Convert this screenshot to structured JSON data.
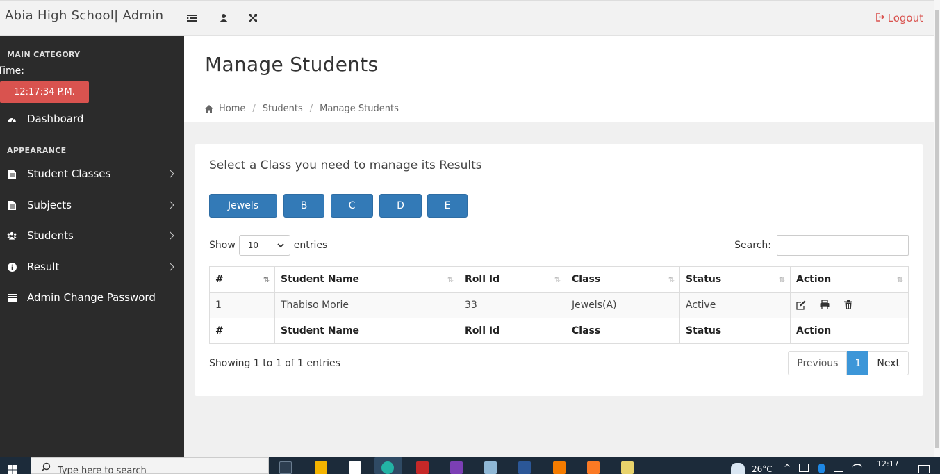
{
  "header": {
    "brand": "Abia High School| Admin",
    "logout_label": "Logout"
  },
  "sidebar": {
    "section1": "MAIN CATEGORY",
    "time_label": "Time:",
    "time_value": "12:17:34 P.M.",
    "dashboard": "Dashboard",
    "section2": "APPEARANCE",
    "items": [
      {
        "label": "Student Classes"
      },
      {
        "label": "Subjects"
      },
      {
        "label": "Students"
      },
      {
        "label": "Result"
      }
    ],
    "change_password": "Admin Change Password"
  },
  "page": {
    "title": "Manage Students",
    "breadcrumb": [
      "Home",
      "Students",
      "Manage Students"
    ]
  },
  "panel": {
    "title": "Select a Class you need to manage its Results",
    "classes": [
      "Jewels",
      "B",
      "C",
      "D",
      "E"
    ],
    "show_label": "Show",
    "show_value": "10",
    "entries_label": "entries",
    "search_label": "Search:",
    "search_value": ""
  },
  "table": {
    "headers": [
      "#",
      "Student Name",
      "Roll Id",
      "Class",
      "Status",
      "Action"
    ],
    "rows": [
      {
        "num": "1",
        "name": "Thabiso Morie",
        "roll": "33",
        "class": "Jewels(A)",
        "status": "Active"
      }
    ]
  },
  "footer": {
    "info": "Showing 1 to 1 of 1 entries",
    "prev": "Previous",
    "page": "1",
    "next": "Next"
  },
  "taskbar": {
    "search_placeholder": "Type here to search",
    "temperature": "26°C",
    "clock": "12:17"
  },
  "colors": {
    "accent": "#337ab7",
    "danger": "#d9534f",
    "sidebar_bg": "#2b2b2b"
  }
}
